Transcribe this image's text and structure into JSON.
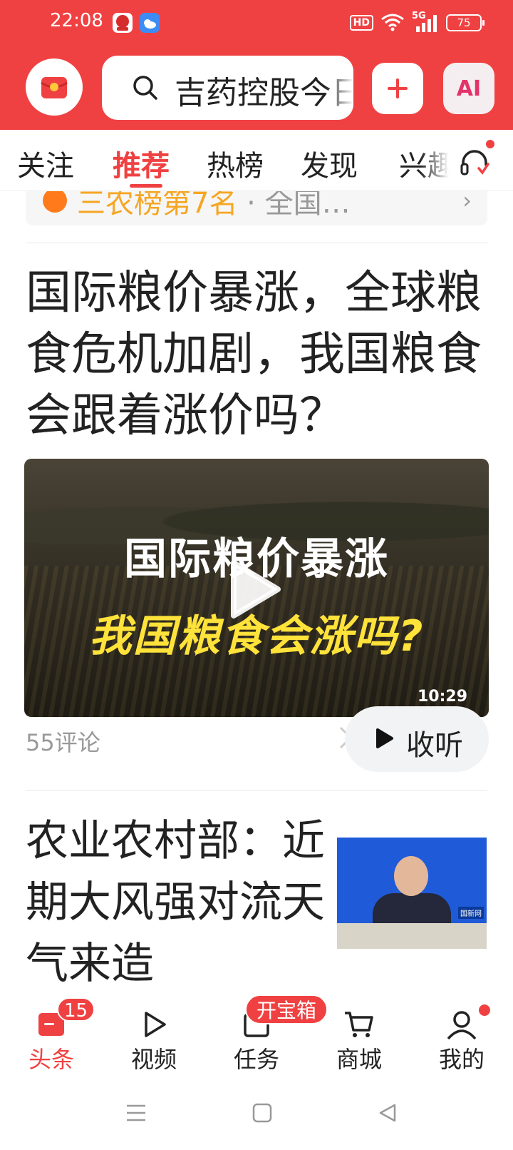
{
  "status_bar": {
    "time": "22:08",
    "network": "5G",
    "battery": "75"
  },
  "header": {
    "search_text": "吉药控股今日",
    "ai_label": "AI",
    "colors": {
      "brand": "#f04142",
      "header_bg": "#f04142"
    }
  },
  "tabs": [
    {
      "label": "关注",
      "active": false
    },
    {
      "label": "推荐",
      "active": true
    },
    {
      "label": "热榜",
      "active": false
    },
    {
      "label": "发现",
      "active": false
    },
    {
      "label": "兴趣",
      "active": false
    }
  ],
  "feed": {
    "hot_strip": {
      "title": "三农榜第7名",
      "separator": " · ",
      "region": "全国…"
    },
    "article1": {
      "title": "国际粮价暴涨，全球粮食危机加剧，我国粮食会跟着涨价吗？",
      "video_line1": "国际粮价暴涨",
      "video_line2": "我国粮食会涨吗?",
      "duration": "10:29",
      "comments": "55评论",
      "listen_label": "收听"
    },
    "article2": {
      "title": "农业农村部：近期大风强对流天气来造",
      "thumb_logo": "国新网"
    }
  },
  "bottom_nav": [
    {
      "label": "头条",
      "icon": "home-icon",
      "badge": "15",
      "active": true
    },
    {
      "label": "视频",
      "icon": "video-play-icon",
      "active": false
    },
    {
      "label": "任务",
      "icon": "task-icon",
      "badge": "开宝箱",
      "active": false
    },
    {
      "label": "商城",
      "icon": "cart-icon",
      "active": false
    },
    {
      "label": "我的",
      "icon": "profile-icon",
      "active": false
    }
  ]
}
